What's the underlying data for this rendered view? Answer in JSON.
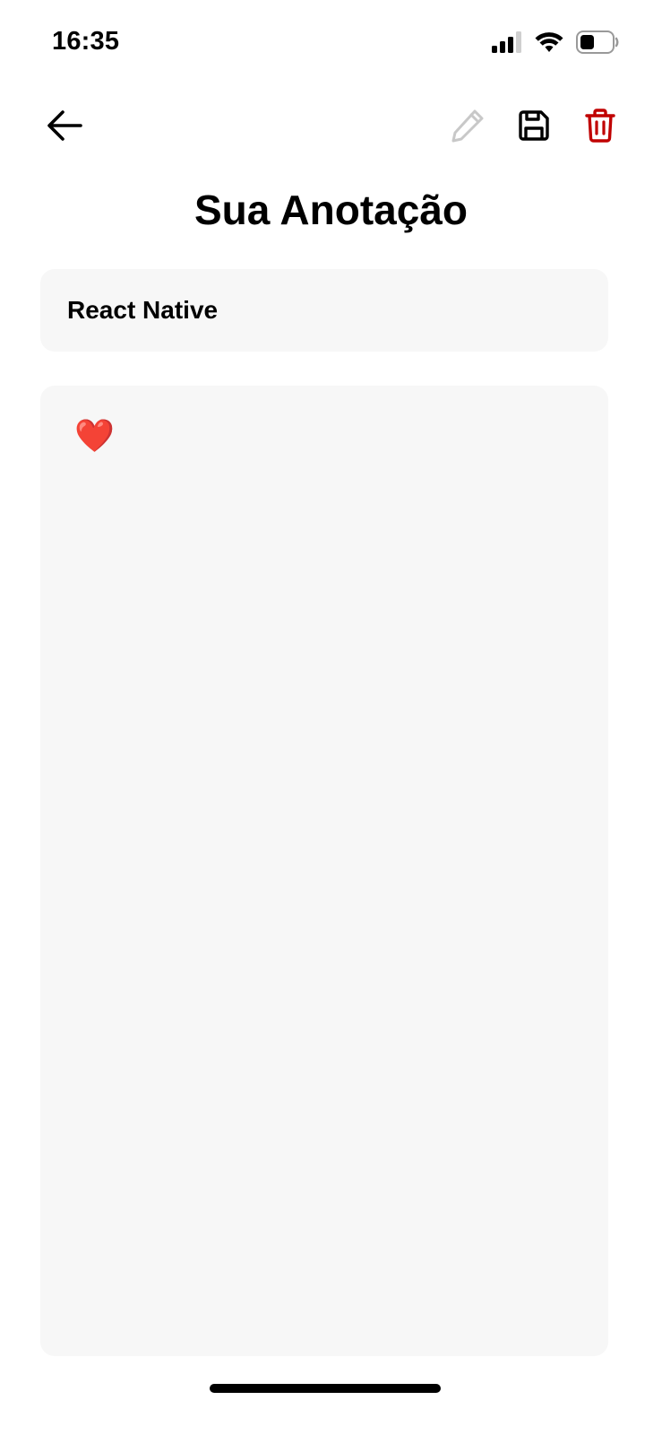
{
  "status_bar": {
    "time": "16:35",
    "icons": [
      "cellular-signal-icon",
      "wifi-icon",
      "battery-icon"
    ]
  },
  "toolbar": {
    "back_icon": "arrow-left-icon",
    "edit_icon": "pencil-icon",
    "save_icon": "floppy-disk-icon",
    "delete_icon": "trash-icon",
    "colors": {
      "edit_disabled": "#c8c8c8",
      "delete": "#c00000"
    }
  },
  "page": {
    "title": "Sua Anotação"
  },
  "note": {
    "title_value": "React Native",
    "body_value": "❤️"
  }
}
